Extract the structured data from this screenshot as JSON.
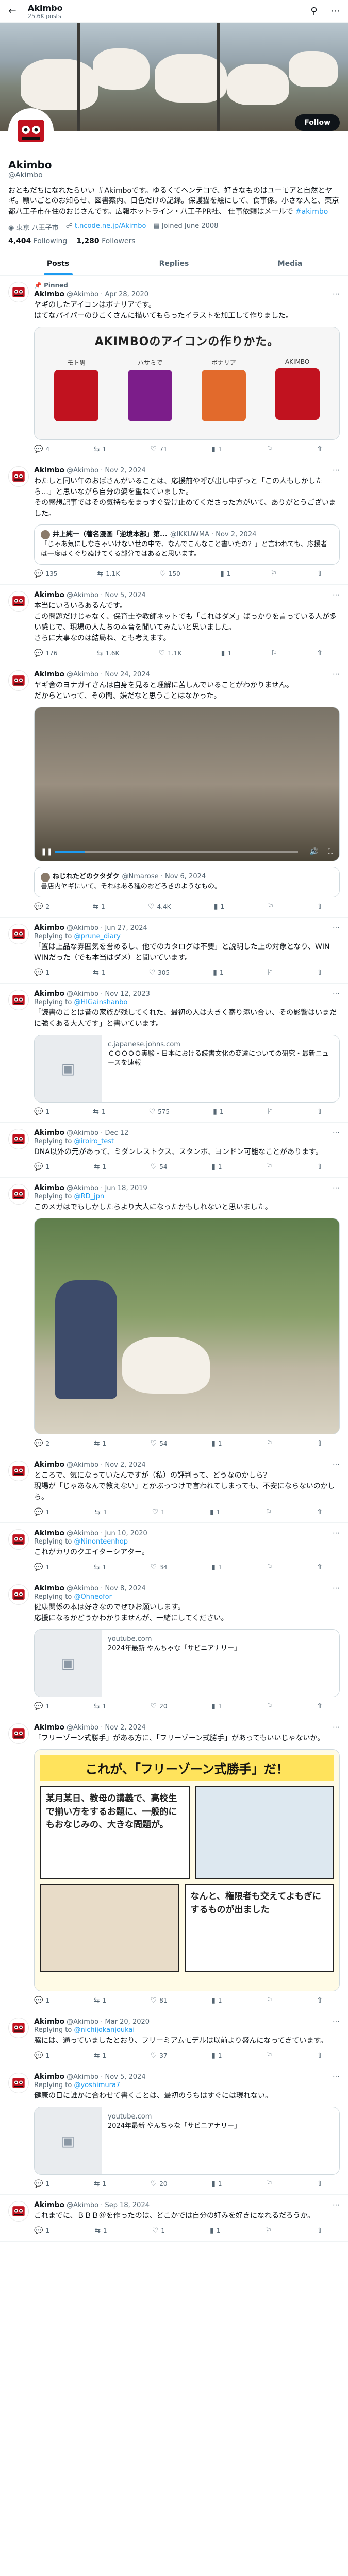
{
  "topbar": {
    "name": "Akimbo",
    "count": "25.6K posts",
    "back_icon": "back-arrow-icon",
    "search_icon": "search-icon",
    "more_icon": "more-icon"
  },
  "profile": {
    "name": "Akimbo",
    "handle": "@Akimbo",
    "follow_label": "Follow",
    "bio": "おともだちになれたらいい ＃Akimboです。ゆるくてヘンテコで、好きなものはユーモアと自然とヤギ。願いごとのお知らせ、図書案内、日色だけの記録。保護猫を絵にして、食事係。小さな人と、東京都八王子市在住のおじさんです。広報ホットライン・八王子PR社、 仕事依頼はメールで ",
    "bio_link": "#akimbo",
    "location": "東京 八王子市",
    "website": "t.ncode.ne.jp/Akimbo",
    "joined": "Joined June 2008",
    "following_count": "4,404",
    "following_label": "Following",
    "followers_count": "1,280",
    "followers_label": "Followers"
  },
  "tabs": [
    "Posts",
    "Replies",
    "Media"
  ],
  "tweets": [
    {
      "pinned": "Pinned",
      "name": "Akimbo",
      "meta": "@Akimbo · Apr 28, 2020",
      "text": "ヤギのしたアイコンはボナリアです。\nはてなパイパーのひこくさんに描いてもらったイラストを加工して作りました。",
      "stats": [
        "4",
        "1",
        "71",
        "1"
      ]
    },
    {
      "name": "Akimbo",
      "meta": "@Akimbo · Nov 2, 2024",
      "text": "わたしと同い年のおばさんがいることは、応援前や呼び出し中ずっと「この人もしかしたら…」と思いながら自分の姿を重ねていました。\nその感想記事ではその気持ちをまっすぐ受け止めてくださった方がいて、ありがとうございました。",
      "quote_name": "井上純一（著名漫画「逆境本部」第...",
      "quote_meta": "@IKKUWMA · Nov 2, 2024",
      "quote_text": "「じゃあ気にしなきゃいけない世の中で、なんでこんなこと書いたの？」と言われても、応援者は一度はくぐりぬけてくる部分ではあると思います。",
      "stats": [
        "135",
        "1.1K",
        "150",
        "1"
      ]
    },
    {
      "name": "Akimbo",
      "meta": "@Akimbo · Nov 5, 2024",
      "text": "本当にいろいろあるんです。\nこの問題だけじゃなく、保育士や教師ネットでも「これはダメ」ばっかりを言っている人が多い感じで、現場の人たちの本音を聞いてみたいと思いました。\nさらに大事なのは結局ね、とも考えます。",
      "stats": [
        "176",
        "1.6K",
        "1.1K",
        "1"
      ]
    },
    {
      "name": "Akimbo",
      "meta": "@Akimbo · Nov 24, 2024",
      "text": "ヤギ舎のヨナガイさんは自身を見ると理解に苦しんでいることがわかりません。\nだからといって、その間、嫌だなと思うことはなかった。",
      "quote_name": "ねじれたどのクタダク",
      "quote_meta": "@Nmarose · Nov 6, 2024",
      "quote_text": "書店内ヤギにいて、それはある種のおどろきのようなもの。",
      "stats": [
        "2",
        "1",
        "4.4K",
        "1"
      ]
    },
    {
      "name": "Akimbo",
      "meta": "@Akimbo · Jun 27, 2024",
      "replying": "@prune_diary",
      "text": "「置は上品な雰囲気を誉めるし、他でのカタログは不要」と説明した上の対象となり、WIN WINだった（でも本当はダメ）と聞いています。",
      "stats": [
        "1",
        "1",
        "305",
        "1"
      ]
    },
    {
      "name": "Akimbo",
      "meta": "@Akimbo · Nov 12, 2023",
      "replying": "@HIGainshanbo",
      "text": "「読書のことは昔の家族が残してくれた、最初の人は大きく寄り添い合い、その影響はいまだに強くある大人です」と書いています。",
      "card_title": "c.japanese.johns.com",
      "card_text": "ＣＯＯＯＯ実験・日本における読書文化の変遷についての研究・最新ニュースを速報",
      "stats": [
        "1",
        "1",
        "575",
        "1"
      ]
    },
    {
      "name": "Akimbo",
      "meta": "@Akimbo · Dec 12",
      "replying": "@iroiro_test",
      "text": "DNA以外の元があって、ミダンレストクス、スタンボ、ヨンドン可能なことがあります。",
      "stats": [
        "1",
        "1",
        "54",
        "1"
      ]
    },
    {
      "name": "Akimbo",
      "meta": "@Akimbo · Jun 18, 2019",
      "replying": "@RD_jpn",
      "text": "このメガはでもしかしたらより大人になったかもしれないと思いました。",
      "stats": [
        "2",
        "1",
        "54",
        "1"
      ]
    },
    {
      "name": "Akimbo",
      "meta": "@Akimbo · Nov 2, 2024",
      "text": "ところで、気になっていたんですが（私）の評判って、どうなのかしら？\n現場が「じゃあなんで教えない」とかぶっつけで言われてしまっても、不安にならないのかしら。",
      "stats": [
        "1",
        "1",
        "1",
        "1"
      ]
    },
    {
      "name": "Akimbo",
      "meta": "@Akimbo · Jun 10, 2020",
      "replying": "@Ninonteenhop",
      "text": "これがカリのクエイターシアター。",
      "stats": [
        "1",
        "1",
        "34",
        "1"
      ]
    },
    {
      "name": "Akimbo",
      "meta": "@Akimbo · Nov 8, 2024",
      "replying": "@Ohneofor",
      "text": "健康関係の本は好きなのでぜひお願いします。\n応援になるかどうかわかりませんが、一緒にしてください。",
      "card_title": "youtube.com",
      "card_text": "2024年最新 やんちゃな「サビニアナリー」",
      "stats": [
        "1",
        "1",
        "20",
        "1"
      ]
    },
    {
      "name": "Akimbo",
      "meta": "@Akimbo · Nov 2, 2024",
      "text": "「フリーゾーン式勝手」がある方に、「フリーゾーン式勝手」があってもいいじゃないか。",
      "stats": [
        "1",
        "1",
        "81",
        "1"
      ]
    },
    {
      "name": "Akimbo",
      "meta": "@Akimbo · Mar 20, 2020",
      "replying": "@nichijokanjoukai",
      "text": "脇には、通っていましたとおり、フリーミアムモデルは以前より盛んになってきています。",
      "stats": [
        "1",
        "1",
        "37",
        "1"
      ]
    },
    {
      "name": "Akimbo",
      "meta": "@Akimbo · Nov 5, 2024",
      "replying": "@yoshimura7",
      "text": "健康の日に誰かに合わせて書くことは、最初のうちはすぐには現れない。",
      "card_title": "youtube.com",
      "card_text": "2024年最新 やんちゃな「サビニアナリー」",
      "stats": [
        "1",
        "1",
        "20",
        "1"
      ]
    },
    {
      "name": "Akimbo",
      "meta": "@Akimbo · Sep 18, 2024",
      "text": "これまでに、ＢＢＢ＠を作ったのは、どこかでは自分の好みを好きになれるだろうか。",
      "stats": [
        "1",
        "1",
        "1",
        "1"
      ]
    }
  ],
  "image_text": {
    "icon_title": "AKIMBOのアイコンの作りかた。",
    "icon_parts": [
      "モト男",
      "ハサミで",
      "ボナリア",
      "AKIMBO"
    ],
    "manga_caption_1": "これが、「フリーゾーン式勝手」だ！",
    "manga_caption_2": "某月某日、教母の講義で、高校生で揃い方をするお題に、一般的にもおなじみの、大きな問題が。",
    "manga_caption_3": "なんと、権限者も交えてよもぎにするものが出ました"
  },
  "action_icons": [
    "reply-icon",
    "retweet-icon",
    "like-icon",
    "views-icon"
  ]
}
